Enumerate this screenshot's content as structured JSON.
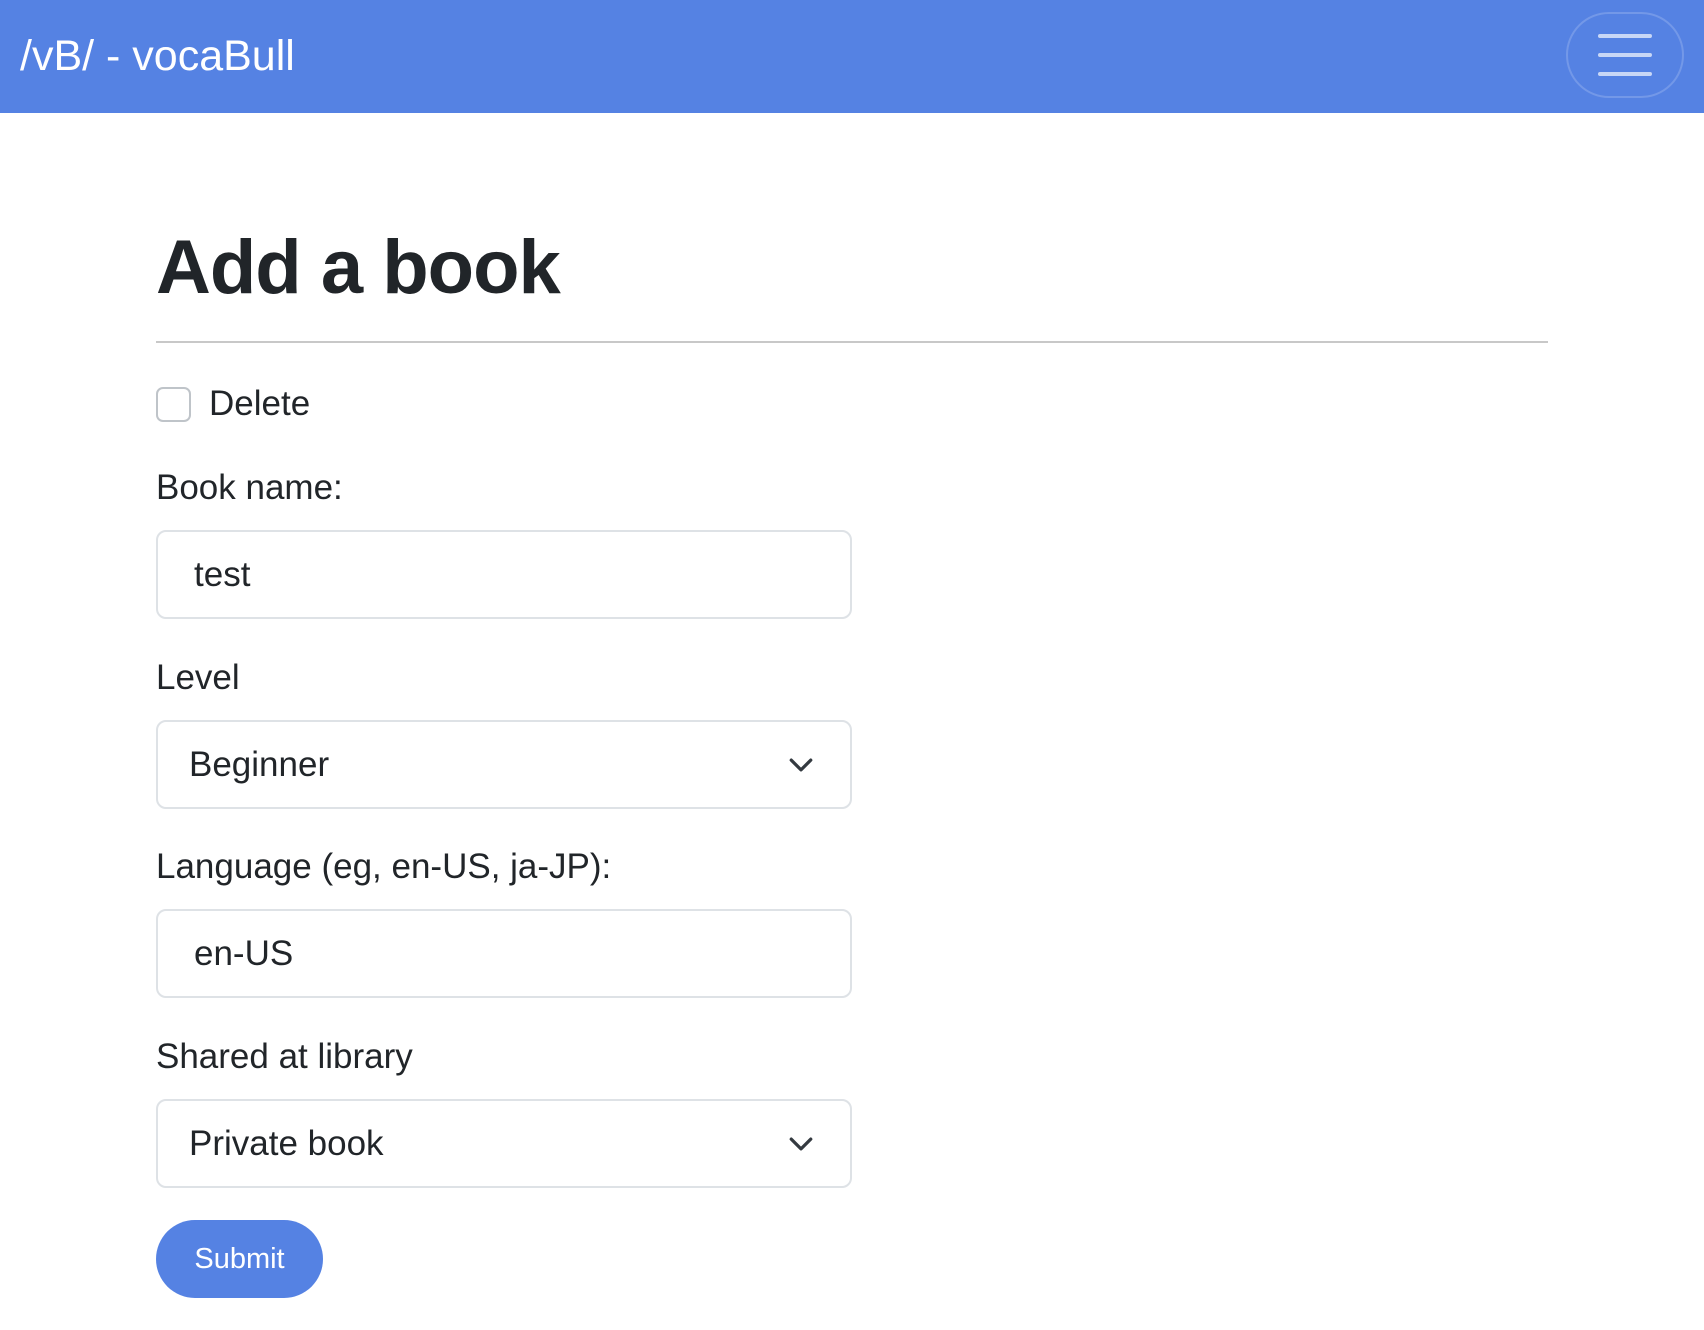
{
  "navbar": {
    "brand": "/vB/ - vocaBull",
    "menu_icon": "hamburger-menu-icon",
    "background_color": "#5582e3"
  },
  "page": {
    "title": "Add a book"
  },
  "form": {
    "delete": {
      "label": "Delete",
      "checked": false
    },
    "book_name": {
      "label": "Book name:",
      "value": "test"
    },
    "level": {
      "label": "Level",
      "selected": "Beginner",
      "icon": "chevron-down-icon"
    },
    "language": {
      "label": "Language (eg, en-US, ja-JP):",
      "value": "en-US"
    },
    "shared": {
      "label": "Shared at library",
      "selected": "Private book",
      "icon": "chevron-down-icon"
    },
    "submit_label": "Submit"
  },
  "colors": {
    "accent": "#5582e3",
    "text": "#212529",
    "border": "#dee2e6"
  }
}
